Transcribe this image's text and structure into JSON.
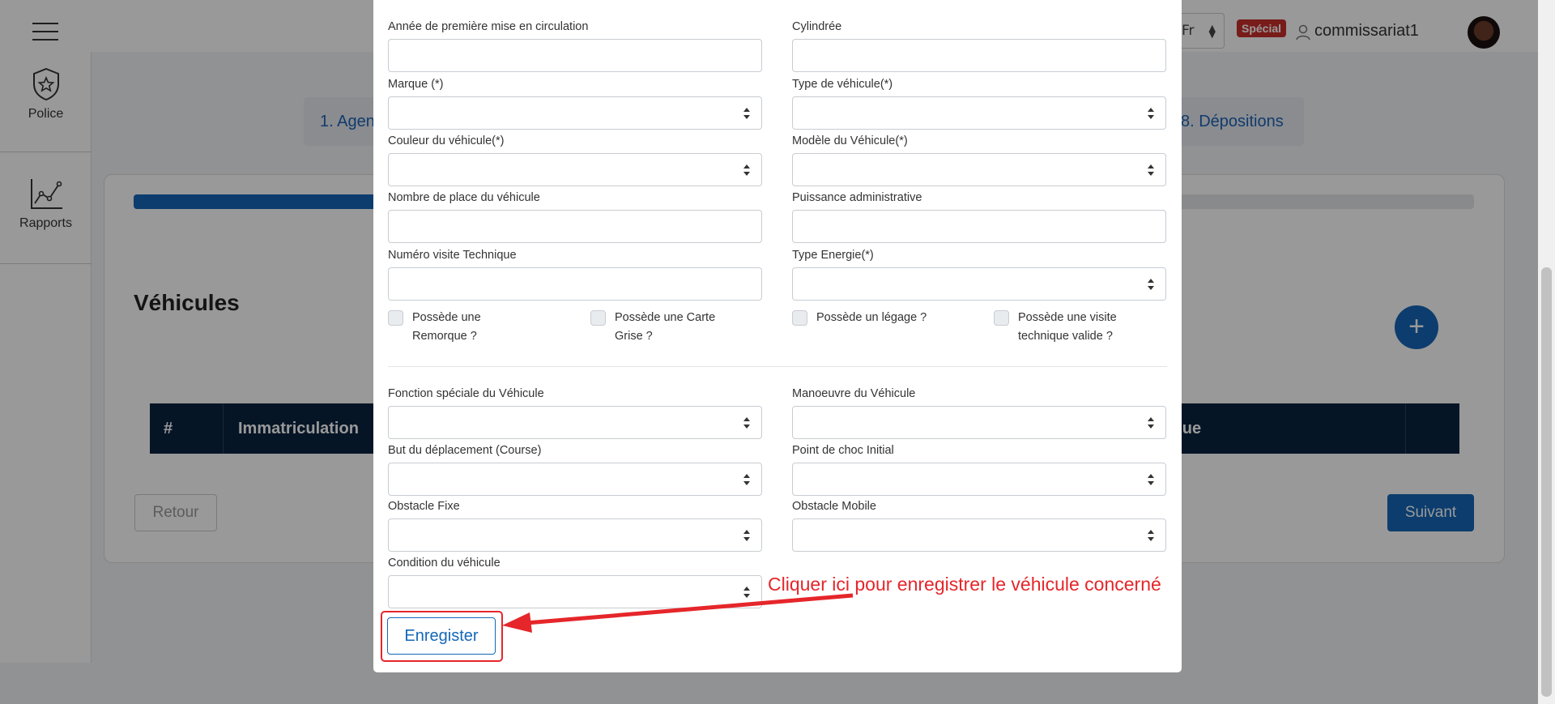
{
  "topbar": {
    "lang": "Fr",
    "special_badge": "Spécial",
    "username": "commissariat1"
  },
  "sidebar": {
    "items": [
      {
        "label": "Police",
        "icon": "police-badge-icon"
      },
      {
        "label": "Rapports",
        "icon": "chart-line-icon"
      }
    ]
  },
  "stepper": {
    "left_label": "1. Agen",
    "right_label": "8. Dépositions"
  },
  "main": {
    "progress_fraction": 0.18,
    "section_title": "Véhicules",
    "add_label": "+",
    "table_headers": [
      "#",
      "Immatriculation",
      "ique"
    ],
    "back_label": "Retour",
    "next_label": "Suivant"
  },
  "modal": {
    "fields": {
      "annee": "Année de première mise en circulation",
      "cylindree": "Cylindrée",
      "marque": "Marque (*)",
      "type_vehicule": "Type de véhicule(*)",
      "couleur": "Couleur du véhicule(*)",
      "modele": "Modèle du Véhicule(*)",
      "nb_places": "Nombre de place du véhicule",
      "puissance": "Puissance administrative",
      "visite": "Numéro visite Technique",
      "energie": "Type Energie(*)",
      "fonction": "Fonction spéciale du Véhicule",
      "manoeuvre": "Manoeuvre du Véhicule",
      "but": "But du déplacement (Course)",
      "choc": "Point de choc Initial",
      "obstacle_fixe": "Obstacle Fixe",
      "obstacle_mobile": "Obstacle Mobile",
      "condition": "Condition du véhicule"
    },
    "checkboxes": {
      "remorque_1": "Possède une",
      "remorque_2": "Remorque ?",
      "carte_1": "Possède une Carte",
      "carte_2": "Grise ?",
      "legage": "Possède un légage ?",
      "visite_1": "Possède une visite",
      "visite_2": "technique valide ?"
    },
    "save_label": "Enregister"
  },
  "annotation": {
    "text": "Cliquer ici pour enregistrer le véhicule concerné",
    "color": "#e5262a"
  },
  "colors": {
    "primary": "#1467b8",
    "table_header": "#0b2340",
    "badge": "#c9302c"
  }
}
